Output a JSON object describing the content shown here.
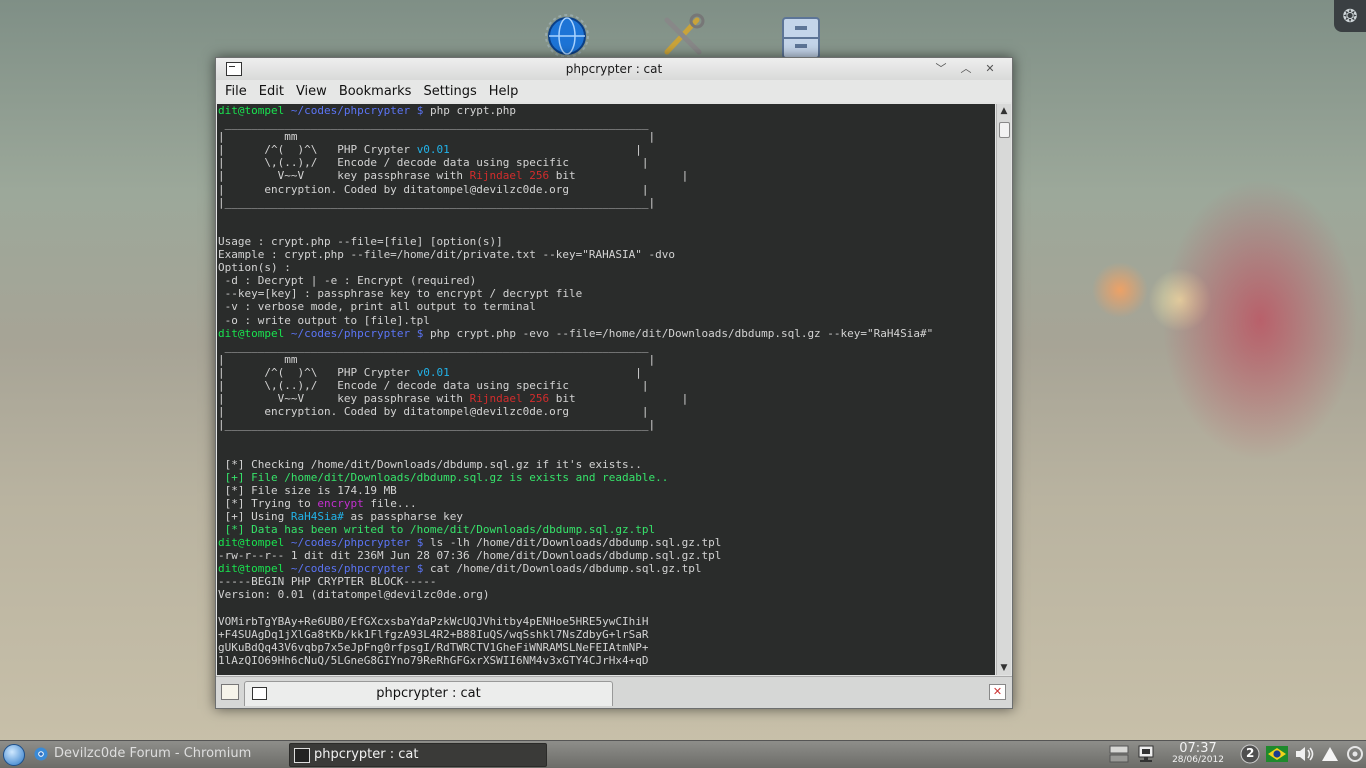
{
  "window": {
    "title": "phpcrypter : cat",
    "controls": [
      "minimize",
      "maximize",
      "close"
    ]
  },
  "menubar": [
    "File",
    "Edit",
    "View",
    "Bookmarks",
    "Settings",
    "Help"
  ],
  "terminal": {
    "prompt_user_host": "dit@tompel",
    "prompt_path": "~/codes/phpcrypter",
    "prompt_symbol": "$",
    "cmd1": "php crypt.php",
    "banner": {
      "border_top": " ________________________________________________________________",
      "line1": "|         mm                                                     |",
      "line2_a": "|      /^(  )^\\   PHP Crypter ",
      "version": "v0.01",
      "line2_b": "                            |",
      "line3": "|      \\,(..),/   Encode / decode data using specific           |",
      "line4_a": "|        V~~V     key passphrase with ",
      "rijndael": "Rijndael 256",
      "line4_b": " bit                |",
      "line5": "|      encryption. Coded by ditatompel@devilzc0de.org           |",
      "border_bottom": "|________________________________________________________________|"
    },
    "usage": [
      "Usage : crypt.php --file=[file] [option(s)]",
      "Example : crypt.php --file=/home/dit/private.txt --key=\"RAHASIA\" -dvo",
      "Option(s) :",
      " -d : Decrypt | -e : Encrypt (required)",
      " --key=[key] : passphrase key to encrypt / decrypt file",
      " -v : verbose mode, print all output to terminal",
      " -o : write output to [file].tpl"
    ],
    "cmd2": "php crypt.php -evo --file=/home/dit/Downloads/dbdump.sql.gz --key=\"RaH4Sia#\"",
    "status": {
      "checking": " [*] Checking /home/dit/Downloads/dbdump.sql.gz if it's exists..",
      "exists": " [+] File /home/dit/Downloads/dbdump.sql.gz is exists and readable..",
      "size": " [*] File size is 174.19 MB",
      "trying_a": " [*] Trying to ",
      "encrypt_word": "encrypt",
      "trying_b": " file...",
      "using_a": " [+] Using ",
      "key_word": "RaH4Sia#",
      "using_b": " as passpharse key",
      "written": " [*] Data has been writed to /home/dit/Downloads/dbdump.sql.gz.tpl"
    },
    "cmd3": "ls -lh /home/dit/Downloads/dbdump.sql.gz.tpl",
    "ls_output": "-rw-r--r-- 1 dit dit 236M Jun 28 07:36 /home/dit/Downloads/dbdump.sql.gz.tpl",
    "cmd4": "cat /home/dit/Downloads/dbdump.sql.gz.tpl",
    "cat_output": [
      "-----BEGIN PHP CRYPTER BLOCK-----",
      "Version: 0.01 (ditatompel@devilzc0de.org)",
      "",
      "VOMirbTgYBAy+Re6UB0/EfGXcxsbaYdaPzkWcUQJVhitby4pENHoe5HRE5ywCIhiH",
      "+F4SUAgDq1jXlGa8tKb/kk1FlfgzA93L4R2+B88IuQS/wqSshkl7NsZdbyG+lrSaR",
      "gUKuBdQq43V6vqbp7x5eJpFng0rfpsgI/RdTWRCTV1GheFiWNRAMSLNeFEIAtmNP+",
      "1lAzQIO69Hh6cNuQ/5LGneG8GIYno79ReRhGFGxrXSWII6NM4v3xGTY4CJrHx4+qD"
    ]
  },
  "tab": {
    "label": "phpcrypter : cat"
  },
  "taskbar": {
    "task1": "Devilzc0de Forum - Chromium",
    "task2": "phpcrypter : cat",
    "clock_time": "07:37",
    "clock_date": "28/06/2012",
    "desktop_number": "2"
  },
  "colors": {
    "green": "#19e34f",
    "blue": "#5b74f4",
    "red": "#d22c2c",
    "cyan": "#22b2e8",
    "magenta": "#c22fcf"
  }
}
